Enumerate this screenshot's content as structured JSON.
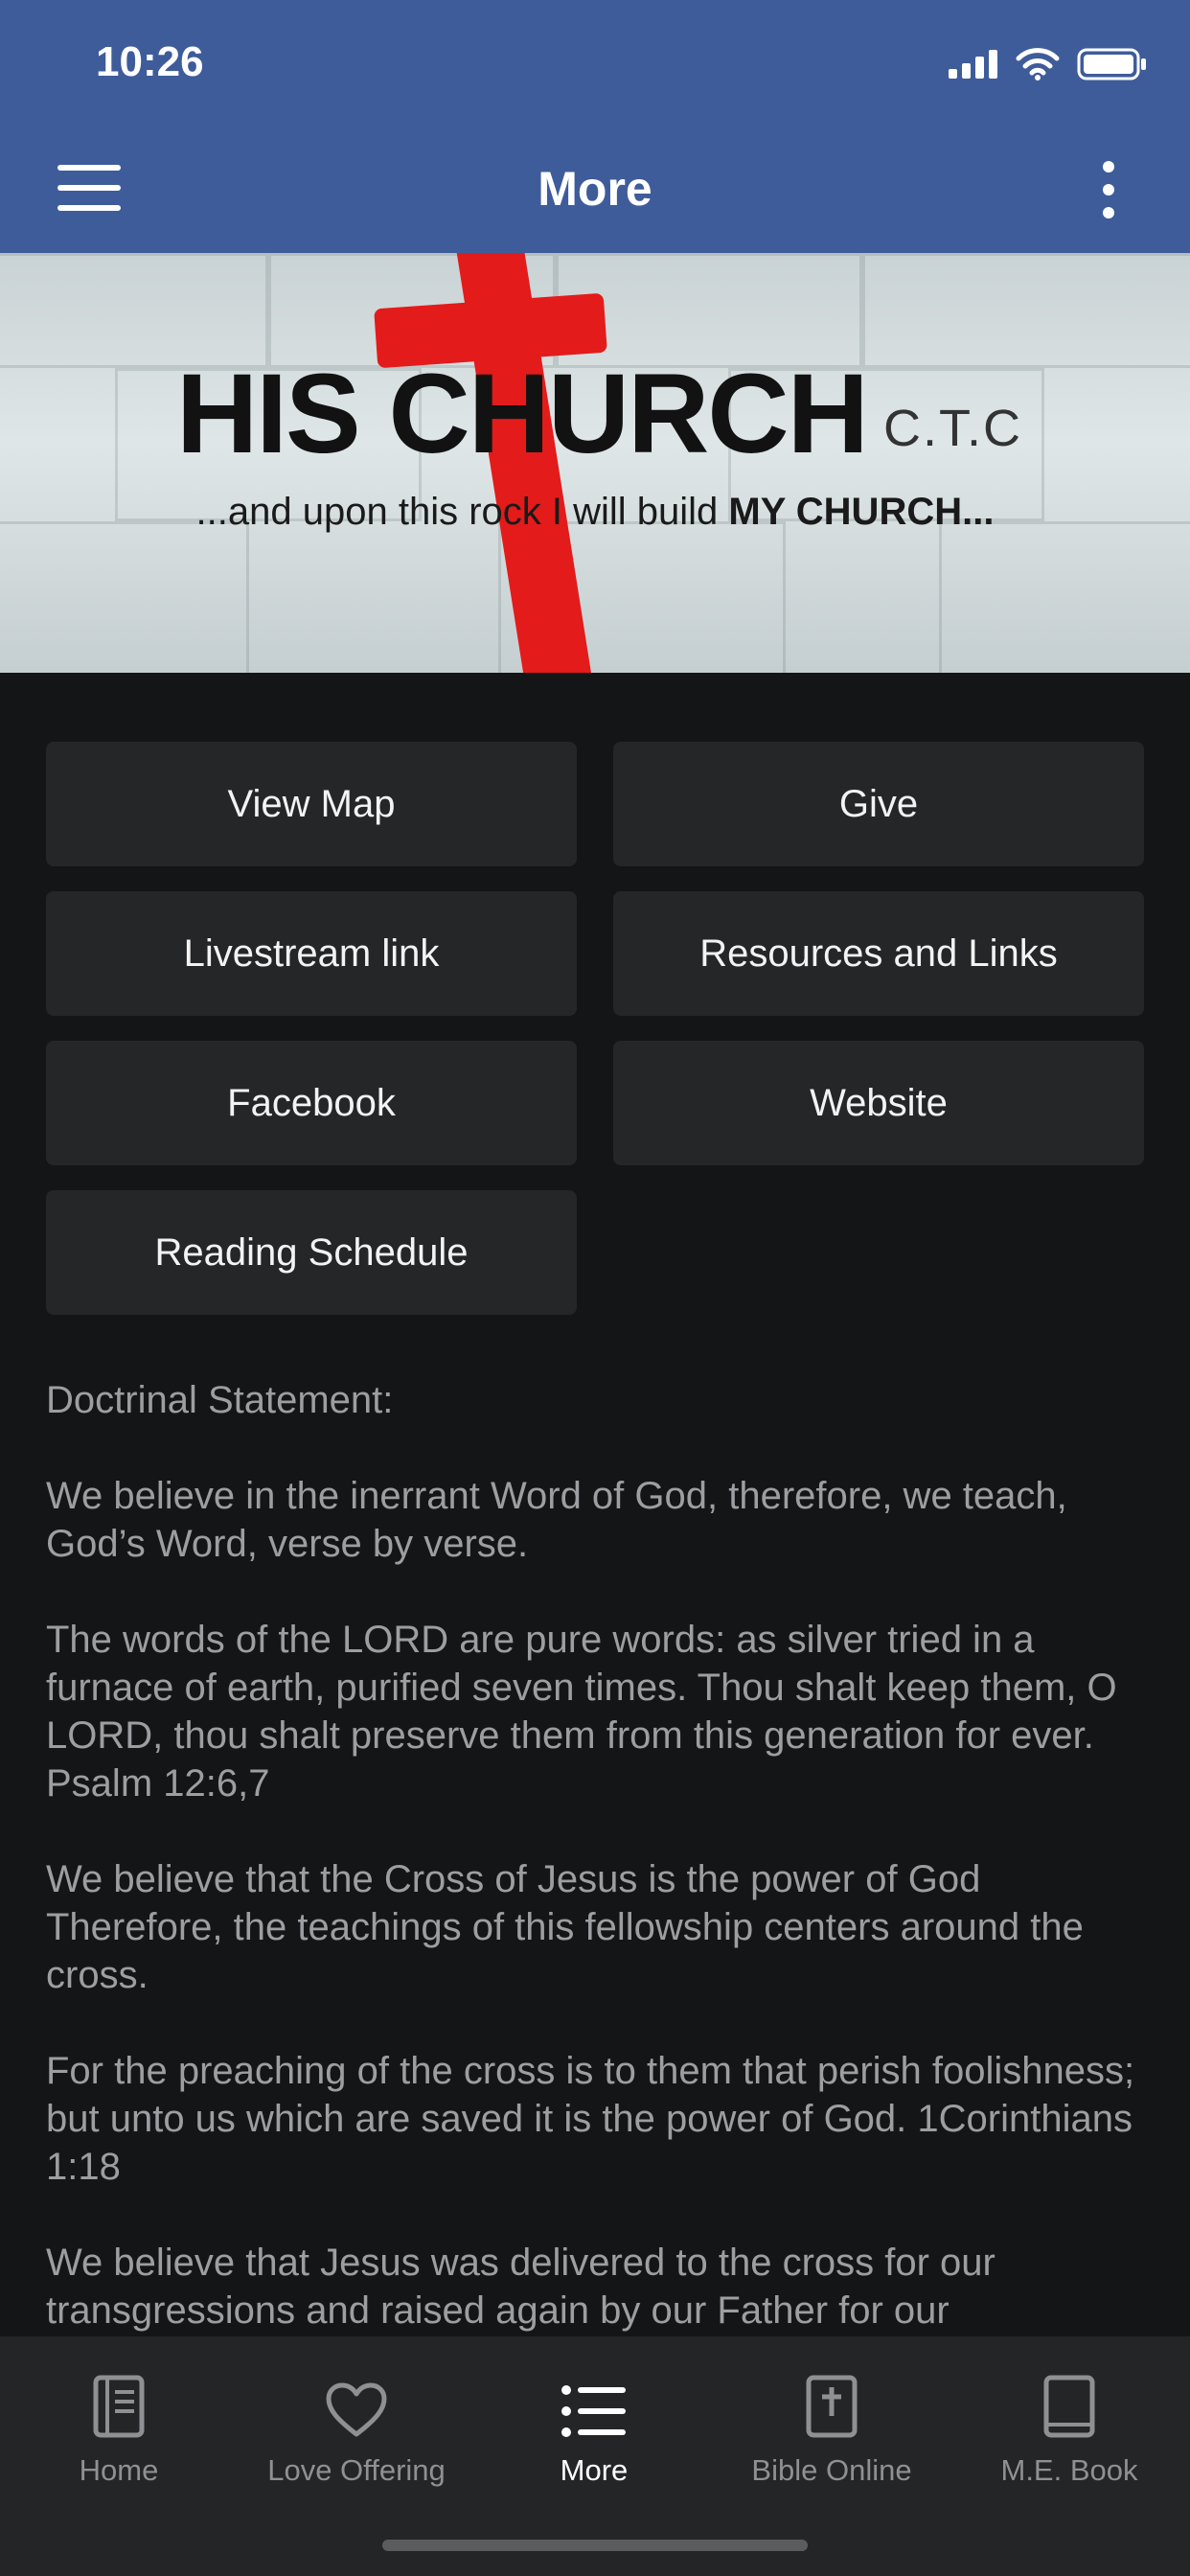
{
  "status_bar": {
    "time": "10:26"
  },
  "header": {
    "title": "More"
  },
  "banner": {
    "brand": "HIS CHURCH",
    "brand_suffix": "C.T.C",
    "tagline_prefix": "...and upon this rock I will build ",
    "tagline_bold": "MY CHURCH...",
    "accent_color": "#e31b1b"
  },
  "buttons": [
    {
      "label": "View Map"
    },
    {
      "label": "Give"
    },
    {
      "label": "Livestream link"
    },
    {
      "label": "Resources and Links"
    },
    {
      "label": "Facebook"
    },
    {
      "label": "Website"
    },
    {
      "label": "Reading Schedule"
    }
  ],
  "statement": {
    "heading": "Doctrinal Statement:",
    "paragraphs": [
      "We believe in the inerrant Word of God, therefore, we teach, God’s Word, verse by verse.",
      "The words of the LORD are pure words: as silver tried in a furnace of earth, purified seven times. Thou shalt keep them, O LORD, thou shalt preserve them from this generation for ever. Psalm 12:6,7",
      "We believe that the Cross of Jesus is the power of God Therefore, the teachings of this fellowship centers around the cross.",
      "For the preaching of the cross is to them that perish foolishness; but unto us which are saved it is the power of God. 1Corinthians 1:18",
      "We believe that Jesus was delivered to the cross for our transgressions and raised again by our Father for our"
    ]
  },
  "tabs": [
    {
      "label": "Home",
      "icon": "book-icon"
    },
    {
      "label": "Love Offering",
      "icon": "heart-icon"
    },
    {
      "label": "More",
      "icon": "list-icon",
      "active": true
    },
    {
      "label": "Bible Online",
      "icon": "bible-cross-icon"
    },
    {
      "label": "M.E. Book",
      "icon": "closed-book-icon"
    }
  ],
  "colors": {
    "header_bg": "#3e5c9a",
    "background": "#141517",
    "button_bg": "#252628",
    "tabbar_bg": "#242526"
  }
}
